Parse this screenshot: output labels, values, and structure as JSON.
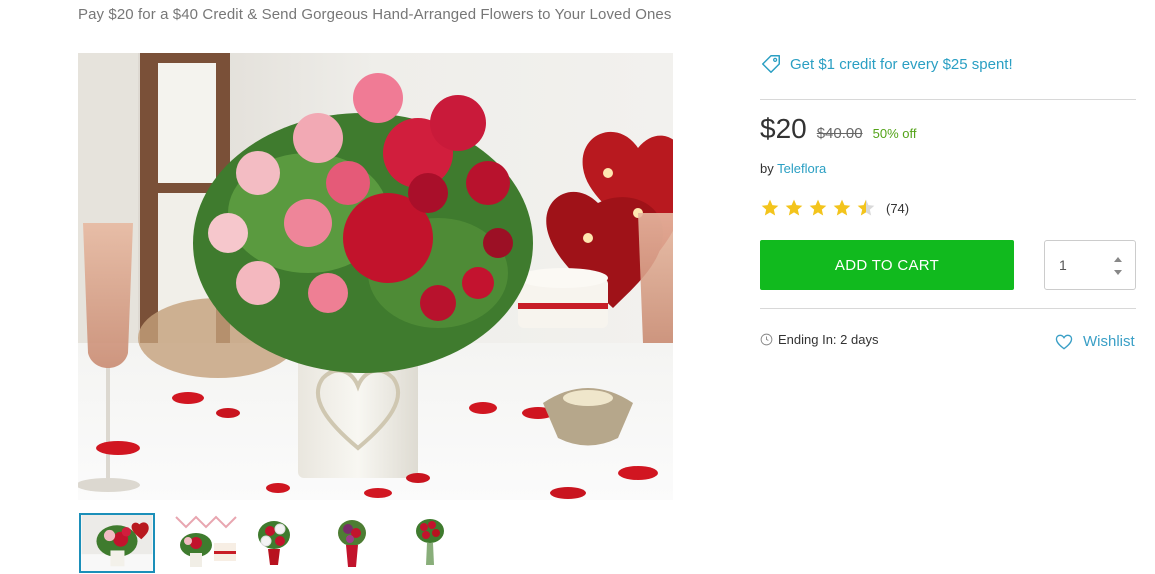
{
  "header": {
    "subtitle": "Pay $20 for a $40 Credit & Send Gorgeous Hand-Arranged Flowers to Your Loved Ones"
  },
  "gallery": {
    "main_image": "flower-arrangement-heart-vase-photo",
    "thumbnails": [
      {
        "icon": "thumbnail-heart-vase-bouquet",
        "active": true
      },
      {
        "icon": "thumbnail-cake-and-flowers",
        "active": false
      },
      {
        "icon": "thumbnail-red-white-bouquet",
        "active": false
      },
      {
        "icon": "thumbnail-purple-red-vase",
        "active": false
      },
      {
        "icon": "thumbnail-red-roses-vase",
        "active": false
      }
    ]
  },
  "promo": {
    "icon": "tag-icon",
    "text": "Get $1 credit for every $25 spent!"
  },
  "pricing": {
    "price": "$20",
    "original_price": "$40.00",
    "discount": "50% off"
  },
  "merchant": {
    "prefix": "by",
    "name": "Teleflora"
  },
  "rating": {
    "stars": 4.5,
    "max_stars": 5,
    "count": "(74)"
  },
  "cart": {
    "add_label": "ADD TO CART",
    "quantity": "1"
  },
  "deal": {
    "icon": "clock-icon",
    "ending_text": "Ending In: 2 days"
  },
  "wishlist": {
    "icon": "heart-outline-icon",
    "label": "Wishlist"
  },
  "colors": {
    "accent_blue": "#2a9fc3",
    "cart_green": "#11ba1e",
    "discount_green": "#53a318",
    "star_gold": "#f3c41c"
  }
}
